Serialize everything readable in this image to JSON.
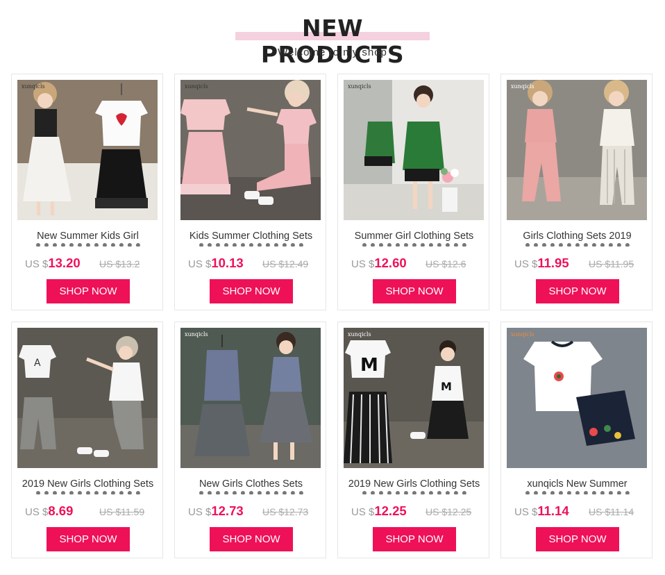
{
  "header": {
    "title": "NEW PRODUCTS",
    "subtitle": "Welcome to my shop"
  },
  "colors": {
    "accent": "#ee1158",
    "title_underline": "#f5d0de",
    "old_price": "#aaaaaa",
    "border": "#e6e6e6"
  },
  "products": [
    {
      "brand": "xunqicls",
      "name": "New Summer Kids Girl",
      "currency": "US $",
      "price": "13.20",
      "old_price": "US $13.2",
      "button": "SHOP NOW"
    },
    {
      "brand": "xunqicls",
      "name": "Kids Summer Clothing Sets",
      "currency": "US $",
      "price": "10.13",
      "old_price": "US $12.49",
      "button": "SHOP NOW"
    },
    {
      "brand": "xunqicls",
      "name": "Summer Girl Clothing Sets",
      "currency": "US $",
      "price": "12.60",
      "old_price": "US $12.6",
      "button": "SHOP NOW"
    },
    {
      "brand": "xunqicls",
      "name": "Girls Clothing Sets 2019",
      "currency": "US $",
      "price": "11.95",
      "old_price": "US $11.95",
      "button": "SHOP NOW"
    },
    {
      "brand": "",
      "name": "2019 New Girls Clothing Sets",
      "currency": "US $",
      "price": "8.69",
      "old_price": "US $11.59",
      "button": "SHOP NOW"
    },
    {
      "brand": "xunqicls",
      "name": "New Girls Clothes Sets",
      "currency": "US $",
      "price": "12.73",
      "old_price": "US $12.73",
      "button": "SHOP NOW"
    },
    {
      "brand": "xunqicls",
      "name": "2019 New Girls Clothing Sets",
      "currency": "US $",
      "price": "12.25",
      "old_price": "US $12.25",
      "button": "SHOP NOW"
    },
    {
      "brand": "xunqicls",
      "name": "xunqicls New Summer",
      "currency": "US $",
      "price": "11.14",
      "old_price": "US $11.14",
      "button": "SHOP NOW"
    }
  ]
}
